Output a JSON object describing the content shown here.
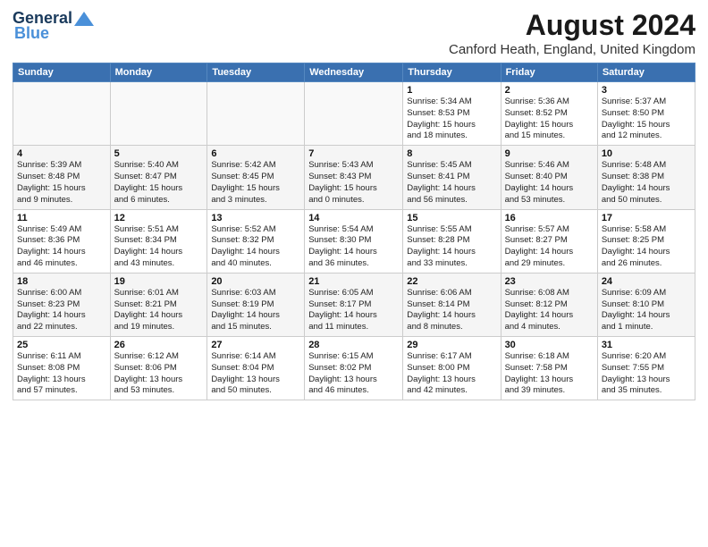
{
  "header": {
    "logo_general": "General",
    "logo_blue": "Blue",
    "title": "August 2024",
    "location": "Canford Heath, England, United Kingdom"
  },
  "weekdays": [
    "Sunday",
    "Monday",
    "Tuesday",
    "Wednesday",
    "Thursday",
    "Friday",
    "Saturday"
  ],
  "weeks": [
    [
      {
        "day": "",
        "info": ""
      },
      {
        "day": "",
        "info": ""
      },
      {
        "day": "",
        "info": ""
      },
      {
        "day": "",
        "info": ""
      },
      {
        "day": "1",
        "info": "Sunrise: 5:34 AM\nSunset: 8:53 PM\nDaylight: 15 hours\nand 18 minutes."
      },
      {
        "day": "2",
        "info": "Sunrise: 5:36 AM\nSunset: 8:52 PM\nDaylight: 15 hours\nand 15 minutes."
      },
      {
        "day": "3",
        "info": "Sunrise: 5:37 AM\nSunset: 8:50 PM\nDaylight: 15 hours\nand 12 minutes."
      }
    ],
    [
      {
        "day": "4",
        "info": "Sunrise: 5:39 AM\nSunset: 8:48 PM\nDaylight: 15 hours\nand 9 minutes."
      },
      {
        "day": "5",
        "info": "Sunrise: 5:40 AM\nSunset: 8:47 PM\nDaylight: 15 hours\nand 6 minutes."
      },
      {
        "day": "6",
        "info": "Sunrise: 5:42 AM\nSunset: 8:45 PM\nDaylight: 15 hours\nand 3 minutes."
      },
      {
        "day": "7",
        "info": "Sunrise: 5:43 AM\nSunset: 8:43 PM\nDaylight: 15 hours\nand 0 minutes."
      },
      {
        "day": "8",
        "info": "Sunrise: 5:45 AM\nSunset: 8:41 PM\nDaylight: 14 hours\nand 56 minutes."
      },
      {
        "day": "9",
        "info": "Sunrise: 5:46 AM\nSunset: 8:40 PM\nDaylight: 14 hours\nand 53 minutes."
      },
      {
        "day": "10",
        "info": "Sunrise: 5:48 AM\nSunset: 8:38 PM\nDaylight: 14 hours\nand 50 minutes."
      }
    ],
    [
      {
        "day": "11",
        "info": "Sunrise: 5:49 AM\nSunset: 8:36 PM\nDaylight: 14 hours\nand 46 minutes."
      },
      {
        "day": "12",
        "info": "Sunrise: 5:51 AM\nSunset: 8:34 PM\nDaylight: 14 hours\nand 43 minutes."
      },
      {
        "day": "13",
        "info": "Sunrise: 5:52 AM\nSunset: 8:32 PM\nDaylight: 14 hours\nand 40 minutes."
      },
      {
        "day": "14",
        "info": "Sunrise: 5:54 AM\nSunset: 8:30 PM\nDaylight: 14 hours\nand 36 minutes."
      },
      {
        "day": "15",
        "info": "Sunrise: 5:55 AM\nSunset: 8:28 PM\nDaylight: 14 hours\nand 33 minutes."
      },
      {
        "day": "16",
        "info": "Sunrise: 5:57 AM\nSunset: 8:27 PM\nDaylight: 14 hours\nand 29 minutes."
      },
      {
        "day": "17",
        "info": "Sunrise: 5:58 AM\nSunset: 8:25 PM\nDaylight: 14 hours\nand 26 minutes."
      }
    ],
    [
      {
        "day": "18",
        "info": "Sunrise: 6:00 AM\nSunset: 8:23 PM\nDaylight: 14 hours\nand 22 minutes."
      },
      {
        "day": "19",
        "info": "Sunrise: 6:01 AM\nSunset: 8:21 PM\nDaylight: 14 hours\nand 19 minutes."
      },
      {
        "day": "20",
        "info": "Sunrise: 6:03 AM\nSunset: 8:19 PM\nDaylight: 14 hours\nand 15 minutes."
      },
      {
        "day": "21",
        "info": "Sunrise: 6:05 AM\nSunset: 8:17 PM\nDaylight: 14 hours\nand 11 minutes."
      },
      {
        "day": "22",
        "info": "Sunrise: 6:06 AM\nSunset: 8:14 PM\nDaylight: 14 hours\nand 8 minutes."
      },
      {
        "day": "23",
        "info": "Sunrise: 6:08 AM\nSunset: 8:12 PM\nDaylight: 14 hours\nand 4 minutes."
      },
      {
        "day": "24",
        "info": "Sunrise: 6:09 AM\nSunset: 8:10 PM\nDaylight: 14 hours\nand 1 minute."
      }
    ],
    [
      {
        "day": "25",
        "info": "Sunrise: 6:11 AM\nSunset: 8:08 PM\nDaylight: 13 hours\nand 57 minutes."
      },
      {
        "day": "26",
        "info": "Sunrise: 6:12 AM\nSunset: 8:06 PM\nDaylight: 13 hours\nand 53 minutes."
      },
      {
        "day": "27",
        "info": "Sunrise: 6:14 AM\nSunset: 8:04 PM\nDaylight: 13 hours\nand 50 minutes."
      },
      {
        "day": "28",
        "info": "Sunrise: 6:15 AM\nSunset: 8:02 PM\nDaylight: 13 hours\nand 46 minutes."
      },
      {
        "day": "29",
        "info": "Sunrise: 6:17 AM\nSunset: 8:00 PM\nDaylight: 13 hours\nand 42 minutes."
      },
      {
        "day": "30",
        "info": "Sunrise: 6:18 AM\nSunset: 7:58 PM\nDaylight: 13 hours\nand 39 minutes."
      },
      {
        "day": "31",
        "info": "Sunrise: 6:20 AM\nSunset: 7:55 PM\nDaylight: 13 hours\nand 35 minutes."
      }
    ]
  ]
}
